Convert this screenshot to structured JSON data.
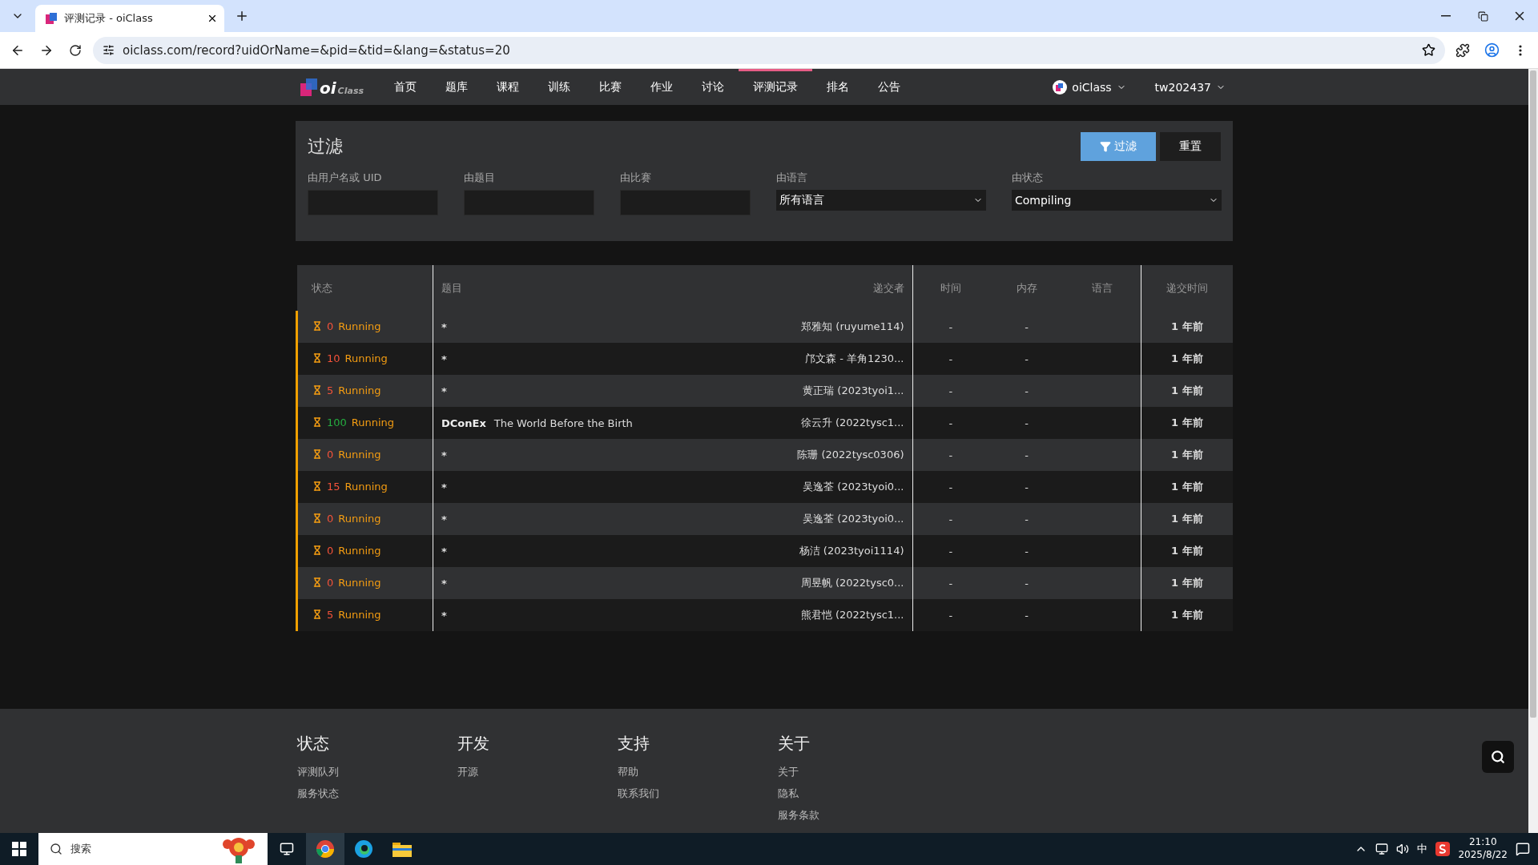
{
  "browser": {
    "tab": {
      "title": "评测记录 - oiClass"
    },
    "url": "oiclass.com/record?uidOrName=&pid=&tid=&lang=&status=20"
  },
  "nav": {
    "logo": {
      "mark": "oi",
      "word": "Class"
    },
    "items": [
      {
        "label": "首页",
        "selected": false
      },
      {
        "label": "题库",
        "selected": false
      },
      {
        "label": "课程",
        "selected": false
      },
      {
        "label": "训练",
        "selected": false
      },
      {
        "label": "比赛",
        "selected": false
      },
      {
        "label": "作业",
        "selected": false
      },
      {
        "label": "讨论",
        "selected": false
      },
      {
        "label": "评测记录",
        "selected": true
      },
      {
        "label": "排名",
        "selected": false
      },
      {
        "label": "公告",
        "selected": false
      }
    ],
    "domain_menu": "oiClass",
    "user_menu": "tw202437"
  },
  "filter": {
    "title": "过滤",
    "apply_button": "过滤",
    "reset_button": "重置",
    "fields": [
      {
        "label": "由用户名或 UID",
        "kind": "input"
      },
      {
        "label": "由题目",
        "kind": "input"
      },
      {
        "label": "由比赛",
        "kind": "input"
      },
      {
        "label": "由语言",
        "kind": "select",
        "value": "所有语言"
      },
      {
        "label": "由状态",
        "kind": "select",
        "value": "Compiling"
      }
    ]
  },
  "table": {
    "columns": [
      "状态",
      "题目",
      "递交者",
      "时间",
      "内存",
      "语言",
      "递交时间"
    ],
    "rows": [
      {
        "score": "0",
        "color": "#f4523a",
        "status": "Running",
        "problem": "*",
        "submitter": "郑雅知 (ruyume114)",
        "time": "-",
        "memory": "-",
        "submitted": "1 年前"
      },
      {
        "score": "10",
        "color": "#f4523a",
        "status": "Running",
        "problem": "*",
        "submitter": "邝文森 - 羊角1230...",
        "time": "-",
        "memory": "-",
        "submitted": "1 年前"
      },
      {
        "score": "5",
        "color": "#f4523a",
        "status": "Running",
        "problem": "*",
        "submitter": "黄正瑞 (2023tyoi1...",
        "time": "-",
        "memory": "-",
        "submitted": "1 年前"
      },
      {
        "score": "100",
        "color": "#25ad40",
        "status": "Running",
        "problem_id": "DConEx",
        "problem": "The World Before the Birth",
        "submitter": "徐云升 (2022tysc1...",
        "time": "-",
        "memory": "-",
        "submitted": "1 年前"
      },
      {
        "score": "0",
        "color": "#f4523a",
        "status": "Running",
        "problem": "*",
        "submitter": "陈珊 (2022tysc0306)",
        "time": "-",
        "memory": "-",
        "submitted": "1 年前"
      },
      {
        "score": "15",
        "color": "#f4523a",
        "status": "Running",
        "problem": "*",
        "submitter": "吴逸荃 (2023tyoi0...",
        "time": "-",
        "memory": "-",
        "submitted": "1 年前"
      },
      {
        "score": "0",
        "color": "#f4523a",
        "status": "Running",
        "problem": "*",
        "submitter": "吴逸荃 (2023tyoi0...",
        "time": "-",
        "memory": "-",
        "submitted": "1 年前"
      },
      {
        "score": "0",
        "color": "#f4523a",
        "status": "Running",
        "problem": "*",
        "submitter": "杨洁 (2023tyoi1114)",
        "time": "-",
        "memory": "-",
        "submitted": "1 年前"
      },
      {
        "score": "0",
        "color": "#f4523a",
        "status": "Running",
        "problem": "*",
        "submitter": "周昱帆 (2022tysc0...",
        "time": "-",
        "memory": "-",
        "submitted": "1 年前"
      },
      {
        "score": "5",
        "color": "#f4523a",
        "status": "Running",
        "problem": "*",
        "submitter": "熊君恺 (2022tysc1...",
        "time": "-",
        "memory": "-",
        "submitted": "1 年前"
      }
    ]
  },
  "footer": {
    "columns": [
      {
        "heading": "状态",
        "links": [
          "评测队列",
          "服务状态"
        ]
      },
      {
        "heading": "开发",
        "links": [
          "开源"
        ]
      },
      {
        "heading": "支持",
        "links": [
          "帮助",
          "联系我们"
        ]
      },
      {
        "heading": "关于",
        "links": [
          "关于",
          "隐私",
          "服务条款"
        ]
      }
    ]
  },
  "taskbar": {
    "search_placeholder": "搜索",
    "ime": "中",
    "time": "21:10",
    "date": "2025/8/22"
  }
}
